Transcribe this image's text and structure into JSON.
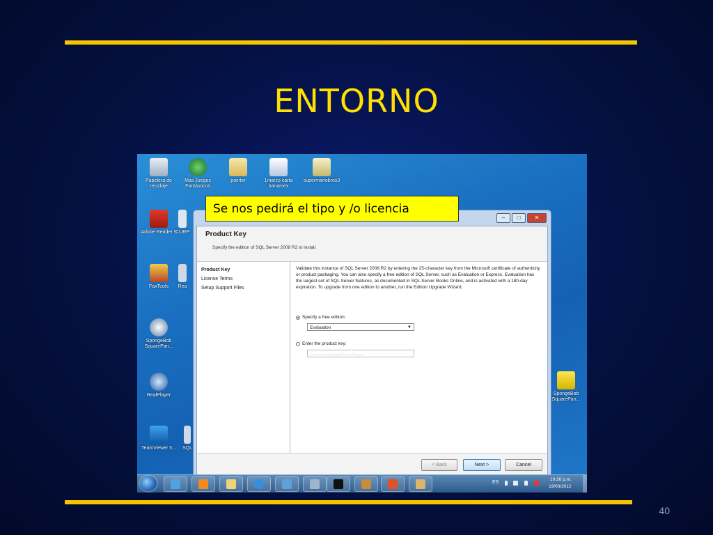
{
  "slide": {
    "title": "ENTORNO",
    "number": "40",
    "callout": "Se nos pedirá el tipo y /o licencia",
    "accent_color": "#f6c500"
  },
  "desktop": {
    "icons": [
      {
        "label": "Papelera de reciclaje",
        "icon": "recycle-bin-icon"
      },
      {
        "label": "Mas Juegos Fantásticos",
        "icon": "globe-icon"
      },
      {
        "label": "pointer",
        "icon": "folder-icon"
      },
      {
        "label": "1marzo carta banamex",
        "icon": "document-icon"
      },
      {
        "label": "supermariobros3",
        "icon": "game-icon"
      },
      {
        "label": "Adobe Reader 9",
        "icon": "pdf-icon"
      },
      {
        "label": "CURP",
        "icon": "document-icon"
      },
      {
        "label": "FaxTools",
        "icon": "fax-icon"
      },
      {
        "label": "Rea",
        "icon": "app-icon"
      },
      {
        "label": "SpongeBob SquarePan...",
        "icon": "flash-icon"
      },
      {
        "label": "RealPlayer",
        "icon": "realplayer-icon"
      },
      {
        "label": "TeamViewer 5...",
        "icon": "teamviewer-icon"
      },
      {
        "label": "SQL",
        "icon": "app-icon"
      },
      {
        "label": "SpongeBob SquarePan...",
        "icon": "spongebob-icon"
      }
    ]
  },
  "installer": {
    "header_title": "Product Key",
    "header_subtitle": "Specify the edition of SQL Server 2008 R2 to install.",
    "nav": [
      "Product Key",
      "License Terms",
      "Setup Support Files"
    ],
    "description": "Validate this instance of SQL Server 2008 R2 by entering the 25-character key from the Microsoft certificate of authenticity or product packaging. You can also specify a free edition of SQL Server, such as Evaluation or Express. Evaluation has the largest set of SQL Server features, as documented in SQL Server Books Online, and is activated with a 180-day expiration. To upgrade from one edition to another, run the Edition Upgrade Wizard.",
    "option_free": "Specify a free edition:",
    "edition_selected": "Evaluation",
    "option_key": "Enter the product key:",
    "key_mask": "_____-_____-_____-_____-_____",
    "btn_back": "< Back",
    "btn_next": "Next >",
    "btn_cancel": "Cancel"
  },
  "taskbar": {
    "lang": "ES",
    "time": "10:26 p.m.",
    "date": "19/03/2012",
    "apps": [
      "explorer-icon",
      "media-player-icon",
      "folder-icon",
      "ie-icon",
      "network-icon",
      "setup-icon",
      "cmd-icon",
      "package-icon",
      "office-icon",
      "installer-icon"
    ]
  }
}
